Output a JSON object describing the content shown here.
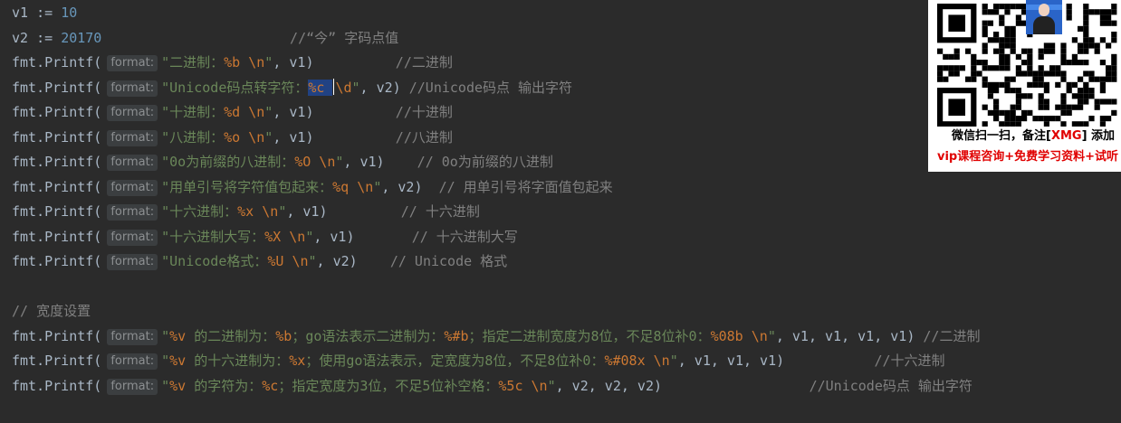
{
  "editor": {
    "param_hint": "format:",
    "lines": [
      [
        {
          "t": "v1 := ",
          "c": "ident"
        },
        {
          "t": "10",
          "c": "num"
        }
      ],
      [
        {
          "t": "v2 := ",
          "c": "ident"
        },
        {
          "t": "20170",
          "c": "num"
        },
        {
          "t": "                       //“今” 字码点值",
          "c": "cmt"
        }
      ],
      [
        {
          "t": "fmt.Printf(",
          "c": "ident"
        },
        {
          "hint": true
        },
        {
          "t": "\"二进制：",
          "c": "str"
        },
        {
          "t": "%b",
          "c": "fmt"
        },
        {
          "t": " ",
          "c": "str"
        },
        {
          "t": "\\n",
          "c": "esc"
        },
        {
          "t": "\"",
          "c": "str"
        },
        {
          "t": ", v1)          ",
          "c": "punc"
        },
        {
          "t": "//二进制",
          "c": "cmt"
        }
      ],
      [
        {
          "t": "fmt.Printf(",
          "c": "ident"
        },
        {
          "hint": true
        },
        {
          "t": "\"Unicode码点转字符：",
          "c": "str"
        },
        {
          "t": "%c",
          "c": "fmt",
          "sel": true
        },
        {
          "t": " ",
          "c": "str",
          "sel": true
        },
        {
          "caret": true
        },
        {
          "t": "\\d",
          "c": "esc"
        },
        {
          "t": "\"",
          "c": "str"
        },
        {
          "t": ", v2) ",
          "c": "punc"
        },
        {
          "t": "//Unicode码点 输出字符",
          "c": "cmt"
        }
      ],
      [
        {
          "t": "fmt.Printf(",
          "c": "ident"
        },
        {
          "hint": true
        },
        {
          "t": "\"十进制：",
          "c": "str"
        },
        {
          "t": "%d",
          "c": "fmt"
        },
        {
          "t": " ",
          "c": "str"
        },
        {
          "t": "\\n",
          "c": "esc"
        },
        {
          "t": "\"",
          "c": "str"
        },
        {
          "t": ", v1)          ",
          "c": "punc"
        },
        {
          "t": "//十进制",
          "c": "cmt"
        }
      ],
      [
        {
          "t": "fmt.Printf(",
          "c": "ident"
        },
        {
          "hint": true
        },
        {
          "t": "\"八进制：",
          "c": "str"
        },
        {
          "t": "%o",
          "c": "fmt"
        },
        {
          "t": " ",
          "c": "str"
        },
        {
          "t": "\\n",
          "c": "esc"
        },
        {
          "t": "\"",
          "c": "str"
        },
        {
          "t": ", v1)          ",
          "c": "punc"
        },
        {
          "t": "//八进制",
          "c": "cmt"
        }
      ],
      [
        {
          "t": "fmt.Printf(",
          "c": "ident"
        },
        {
          "hint": true
        },
        {
          "t": "\"0o为前缀的八进制：",
          "c": "str"
        },
        {
          "t": "%O",
          "c": "fmt"
        },
        {
          "t": " ",
          "c": "str"
        },
        {
          "t": "\\n",
          "c": "esc"
        },
        {
          "t": "\"",
          "c": "str"
        },
        {
          "t": ", v1)    ",
          "c": "punc"
        },
        {
          "t": "// 0o为前缀的八进制",
          "c": "cmt"
        }
      ],
      [
        {
          "t": "fmt.Printf(",
          "c": "ident"
        },
        {
          "hint": true
        },
        {
          "t": "\"用单引号将字符值包起来：",
          "c": "str"
        },
        {
          "t": "%q",
          "c": "fmt"
        },
        {
          "t": " ",
          "c": "str"
        },
        {
          "t": "\\n",
          "c": "esc"
        },
        {
          "t": "\"",
          "c": "str"
        },
        {
          "t": ", v2)  ",
          "c": "punc"
        },
        {
          "t": "// 用单引号将字面值包起来",
          "c": "cmt"
        }
      ],
      [
        {
          "t": "fmt.Printf(",
          "c": "ident"
        },
        {
          "hint": true
        },
        {
          "t": "\"十六进制：",
          "c": "str"
        },
        {
          "t": "%x",
          "c": "fmt"
        },
        {
          "t": " ",
          "c": "str"
        },
        {
          "t": "\\n",
          "c": "esc"
        },
        {
          "t": "\"",
          "c": "str"
        },
        {
          "t": ", v1)         ",
          "c": "punc"
        },
        {
          "t": "// 十六进制",
          "c": "cmt"
        }
      ],
      [
        {
          "t": "fmt.Printf(",
          "c": "ident"
        },
        {
          "hint": true
        },
        {
          "t": "\"十六进制大写：",
          "c": "str"
        },
        {
          "t": "%X",
          "c": "fmt"
        },
        {
          "t": " ",
          "c": "str"
        },
        {
          "t": "\\n",
          "c": "esc"
        },
        {
          "t": "\"",
          "c": "str"
        },
        {
          "t": ", v1)       ",
          "c": "punc"
        },
        {
          "t": "// 十六进制大写",
          "c": "cmt"
        }
      ],
      [
        {
          "t": "fmt.Printf(",
          "c": "ident"
        },
        {
          "hint": true
        },
        {
          "t": "\"Unicode格式：",
          "c": "str"
        },
        {
          "t": "%U",
          "c": "fmt"
        },
        {
          "t": " ",
          "c": "str"
        },
        {
          "t": "\\n",
          "c": "esc"
        },
        {
          "t": "\"",
          "c": "str"
        },
        {
          "t": ", v2)    ",
          "c": "punc"
        },
        {
          "t": "// Unicode 格式",
          "c": "cmt"
        }
      ],
      [],
      [
        {
          "t": "// 宽度设置",
          "c": "cmt"
        }
      ],
      [
        {
          "t": "fmt.Printf(",
          "c": "ident"
        },
        {
          "hint": true
        },
        {
          "t": "\"",
          "c": "str"
        },
        {
          "t": "%v",
          "c": "fmt"
        },
        {
          "t": " 的二进制为：",
          "c": "str"
        },
        {
          "t": "%b",
          "c": "fmt"
        },
        {
          "t": "；go语法表示二进制为：",
          "c": "str"
        },
        {
          "t": "%#b",
          "c": "fmt"
        },
        {
          "t": "；指定二进制宽度为8位，不足8位补0：",
          "c": "str"
        },
        {
          "t": "%08b",
          "c": "fmt"
        },
        {
          "t": " ",
          "c": "str"
        },
        {
          "t": "\\n",
          "c": "esc"
        },
        {
          "t": "\"",
          "c": "str"
        },
        {
          "t": ", v1, v1, v1, v1) ",
          "c": "punc"
        },
        {
          "t": "//二进制",
          "c": "cmt"
        }
      ],
      [
        {
          "t": "fmt.Printf(",
          "c": "ident"
        },
        {
          "hint": true
        },
        {
          "t": "\"",
          "c": "str"
        },
        {
          "t": "%v",
          "c": "fmt"
        },
        {
          "t": " 的十六进制为：",
          "c": "str"
        },
        {
          "t": "%x",
          "c": "fmt"
        },
        {
          "t": "；使用go语法表示，定宽度为8位，不足8位补0：",
          "c": "str"
        },
        {
          "t": "%#08x",
          "c": "fmt"
        },
        {
          "t": " ",
          "c": "str"
        },
        {
          "t": "\\n",
          "c": "esc"
        },
        {
          "t": "\"",
          "c": "str"
        },
        {
          "t": ", v1, v1, v1)           ",
          "c": "punc"
        },
        {
          "t": "//十六进制",
          "c": "cmt"
        }
      ],
      [
        {
          "t": "fmt.Printf(",
          "c": "ident"
        },
        {
          "hint": true
        },
        {
          "t": "\"",
          "c": "str"
        },
        {
          "t": "%v",
          "c": "fmt"
        },
        {
          "t": " 的字符为：",
          "c": "str"
        },
        {
          "t": "%c",
          "c": "fmt"
        },
        {
          "t": "；指定宽度为3位，不足5位补空格：",
          "c": "str"
        },
        {
          "t": "%5c",
          "c": "fmt"
        },
        {
          "t": " ",
          "c": "str"
        },
        {
          "t": "\\n",
          "c": "esc"
        },
        {
          "t": "\"",
          "c": "str"
        },
        {
          "t": ", v2, v2, v2)                  ",
          "c": "punc"
        },
        {
          "t": "//Unicode码点 输出字符",
          "c": "cmt"
        }
      ]
    ]
  },
  "qr_popup": {
    "caption_prefix": "微信扫一扫，备注[",
    "caption_tag": "XMG",
    "caption_suffix": "] 添加",
    "promo": "vip课程咨询+免费学习资料+试听"
  },
  "colors": {
    "background": "#2b2b2b",
    "identifier": "#a9b7c6",
    "number": "#6897bb",
    "string": "#6a8759",
    "format_verb": "#cc7832",
    "comment": "#808080",
    "selection": "#214283",
    "accent_red": "#e00000"
  }
}
